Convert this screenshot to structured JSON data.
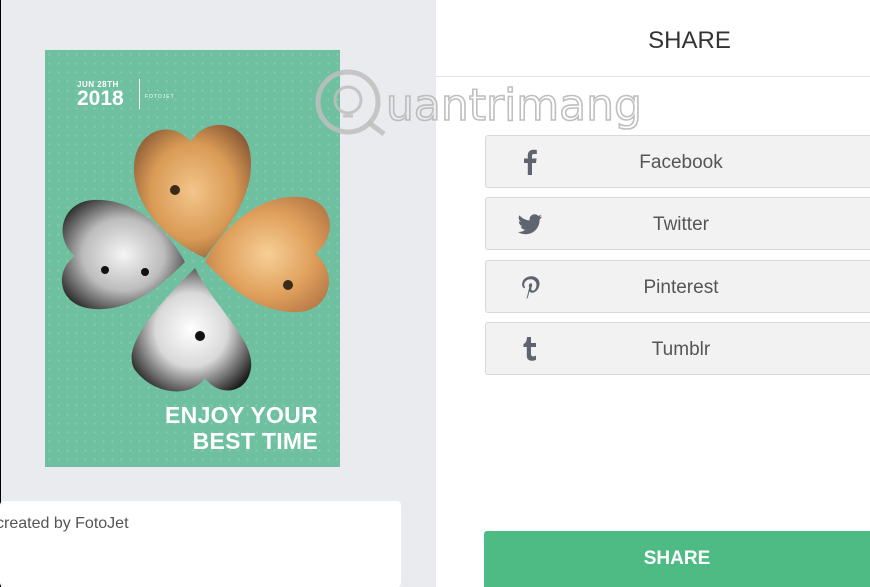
{
  "poster": {
    "date_small": "JUN 28TH",
    "year": "2018",
    "brand": "FOTOJET",
    "slogan_line1": "ENJOY YOUR",
    "slogan_line2": "BEST TIME"
  },
  "caption": {
    "text": "created by FotoJet"
  },
  "watermark": {
    "text": "Quantrimang"
  },
  "share_panel": {
    "title": "SHARE",
    "buttons": [
      {
        "label": "Facebook",
        "icon": "facebook-icon"
      },
      {
        "label": "Twitter",
        "icon": "twitter-icon"
      },
      {
        "label": "Pinterest",
        "icon": "pinterest-icon"
      },
      {
        "label": "Tumblr",
        "icon": "tumblr-icon"
      }
    ],
    "submit_label": "SHARE"
  },
  "colors": {
    "poster_bg": "#6ec0a0",
    "share_accent": "#4fbb84",
    "left_bg": "#e9ebee"
  }
}
